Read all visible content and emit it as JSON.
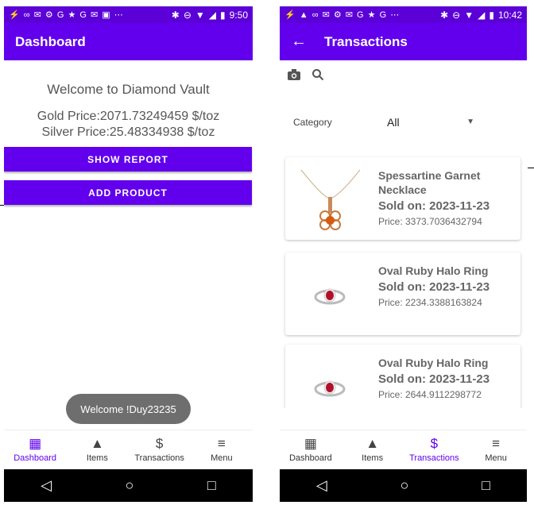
{
  "left_screen": {
    "status": {
      "icons": "⚡ ∞ ✉ ⚙ G ★ G ✉ ▣ ⋯",
      "time": "9:50"
    },
    "appbar": {
      "title": "Dashboard"
    },
    "welcome": "Welcome to Diamond Vault",
    "gold_price": "Gold Price:2071.73249459 $/toz",
    "silver_price": "Silver Price:25.48334938 $/toz",
    "buttons": {
      "show_report": "SHOW REPORT",
      "add_product": "ADD PRODUCT"
    },
    "toast": "Welcome !Duy23235"
  },
  "right_screen": {
    "status": {
      "icons": "⚡ ▲ ∞ ✉ ⚙ ✉ G ★ G ⋯",
      "time": "10:42"
    },
    "appbar": {
      "title": "Transactions"
    },
    "filter": {
      "label": "Category",
      "value": "All"
    },
    "transactions": [
      {
        "name": "Spessartine Garnet Necklace",
        "sold": "Sold on: 2023-11-23",
        "price": "Price: 3373.7036432794"
      },
      {
        "name": "Oval Ruby Halo Ring",
        "sold": "Sold on: 2023-11-23",
        "price": "Price: 2234.3388163824"
      },
      {
        "name": "Oval Ruby Halo Ring",
        "sold": "Sold on: 2023-11-23",
        "price": "Price: 2644.9112298772"
      }
    ]
  },
  "nav": [
    {
      "label": "Dashboard",
      "icon": "dashboard-icon"
    },
    {
      "label": "Items",
      "icon": "shapes-icon"
    },
    {
      "label": "Transactions",
      "icon": "dollar-icon"
    },
    {
      "label": "Menu",
      "icon": "menu-icon"
    }
  ],
  "colors": {
    "primary": "#6200ee",
    "status_bar": "#5b00d6",
    "toast": "#6e6e6e"
  }
}
